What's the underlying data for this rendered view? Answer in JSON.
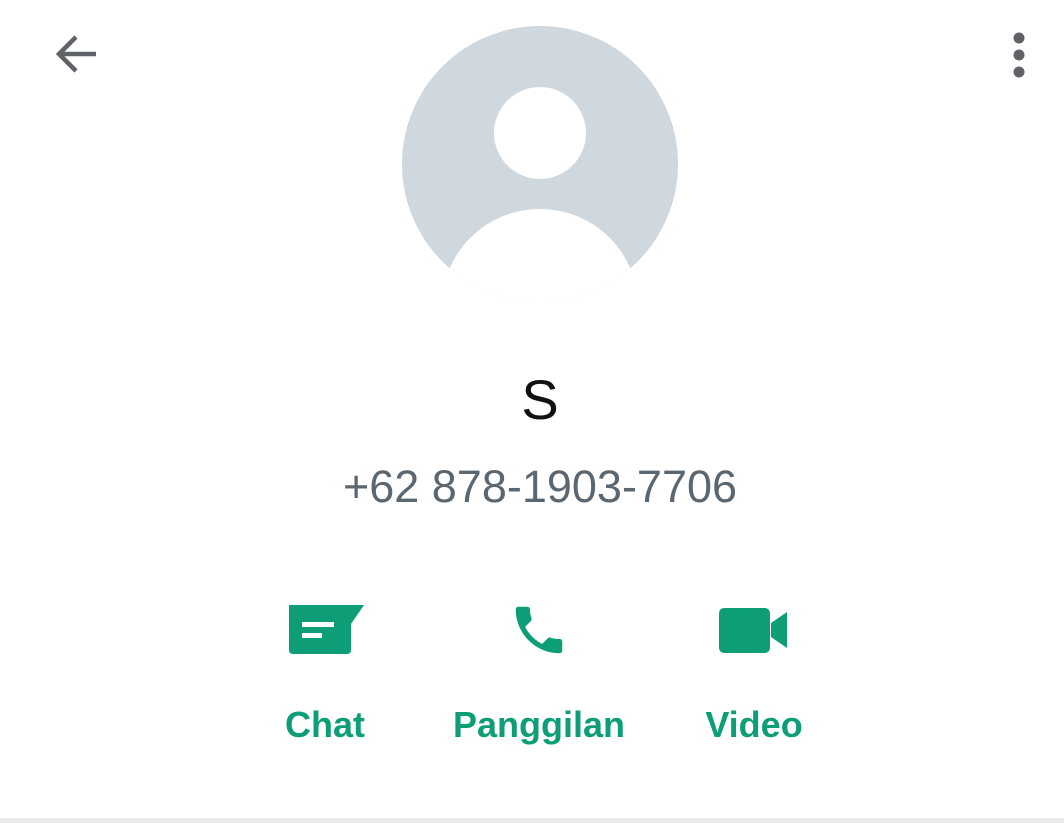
{
  "header": {
    "back_icon": "arrow-left-icon",
    "menu_icon": "more-vert-icon"
  },
  "avatar": {
    "icon": "default-person-avatar",
    "bg_color": "#cfd8df"
  },
  "contact": {
    "name": "S",
    "phone": "+62 878-1903-7706"
  },
  "actions": [
    {
      "label": "Chat",
      "icon": "chat-icon"
    },
    {
      "label": "Panggilan",
      "icon": "phone-icon"
    },
    {
      "label": "Video",
      "icon": "videocam-icon"
    }
  ],
  "colors": {
    "accent": "#0d9e78",
    "icon_gray": "#5f6368",
    "phone_text": "#5b6770"
  }
}
